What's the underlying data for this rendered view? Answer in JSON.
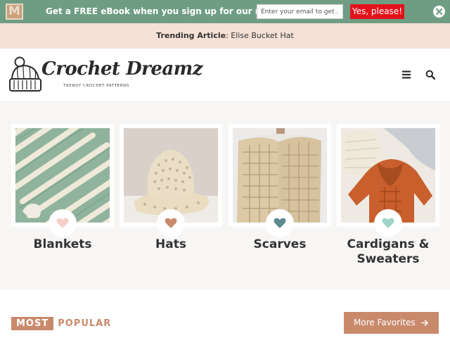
{
  "newsletter": {
    "logo_letter": "M",
    "text": "Get a FREE eBook when you sign up for our newsletter",
    "email_placeholder": "Enter your email to get ...",
    "submit_label": "Yes, please!",
    "close_icon": "close-icon",
    "bar_color": "#6f9d83",
    "button_color": "#e3131c"
  },
  "trending": {
    "label": "Trending Article",
    "separator": ": ",
    "article": "Elise Bucket Hat"
  },
  "header": {
    "logo_name": "Crochet Dreamz",
    "logo_tagline": "TRENDY CROCHET PATTERNS",
    "menu_icon": "hamburger-menu-icon",
    "search_icon": "search-icon"
  },
  "categories": [
    {
      "label": "Blankets",
      "heart_color": "#f5cfc7",
      "photo": "green-striped-blanket"
    },
    {
      "label": "Hats",
      "heart_color": "#c98a6c",
      "photo": "cream-bucket-hat"
    },
    {
      "label": "Scarves",
      "heart_color": "#5c8a8f",
      "photo": "cream-scarf"
    },
    {
      "label": "Cardigans & Sweaters",
      "heart_color": "#9fd3c7",
      "photo": "orange-baby-sweater"
    }
  ],
  "popular": {
    "title_part1": "MOST",
    "title_part2": "POPULAR",
    "more_button": "More Favorites",
    "arrow_icon": "arrow-right-icon",
    "accent_color": "#c98a6c"
  }
}
